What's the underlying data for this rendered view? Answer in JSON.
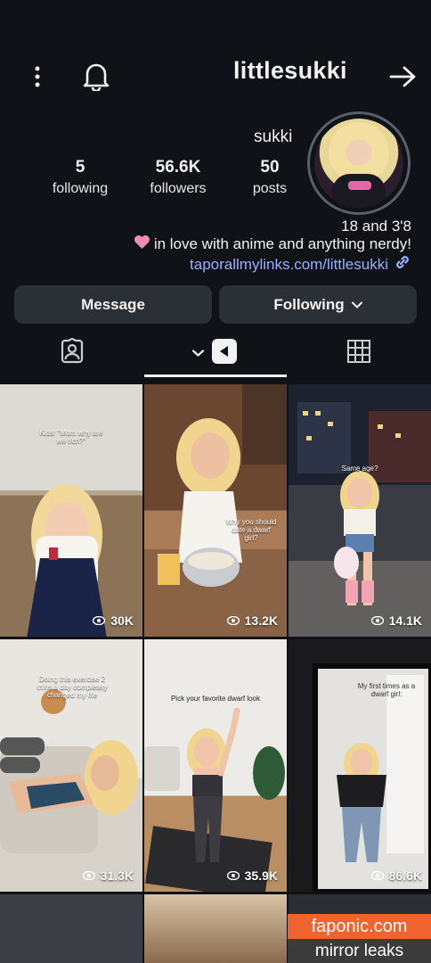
{
  "header": {
    "username": "littlesukki",
    "display_name": "sukki"
  },
  "stats": [
    {
      "value": "50",
      "label": "posts"
    },
    {
      "value": "56.6K",
      "label": "followers"
    },
    {
      "value": "5",
      "label": "following"
    }
  ],
  "bio": {
    "line1": "18 and 3'8",
    "line2": "in love with anime and anything nerdy!",
    "link": "taporallmylinks.com/littlesukki"
  },
  "actions": {
    "following_label": "Following",
    "message_label": "Message"
  },
  "posts": [
    {
      "views": "30K",
      "caption": "Kids: \"Mom why are we rich?\""
    },
    {
      "views": "13.2K",
      "caption": "Why you should date a dwarf girl?"
    },
    {
      "views": "14.1K",
      "caption": "Same age?"
    },
    {
      "views": "31.3K",
      "caption": "Doing this exercise 2 mins a day completely changed my life"
    },
    {
      "views": "35.9K",
      "caption": "Pick your favorite dwarf look"
    },
    {
      "views": "86.6K",
      "caption": "My first times as a dwarf girl:"
    }
  ],
  "watermark": {
    "site": "faponic.com",
    "tagline": "mirror leaks"
  },
  "colors": {
    "background": "#0f1216",
    "button": "#2b2f36",
    "link": "#9aaeff",
    "heart": "#f28bb4",
    "watermark_orange": "#f0632e"
  }
}
